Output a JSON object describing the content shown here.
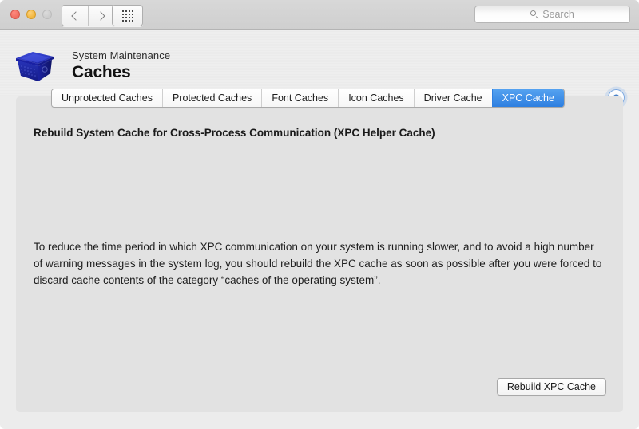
{
  "window": {
    "traffic_lights": [
      {
        "name": "close",
        "color": "#ef6c5f"
      },
      {
        "name": "minimize",
        "color": "#f0b43c"
      },
      {
        "name": "zoom",
        "color": "#cbcbcb"
      }
    ]
  },
  "toolbar": {
    "back_icon": "chevron-left-icon",
    "forward_icon": "chevron-right-icon",
    "grid_icon": "grid-view-icon",
    "search": {
      "icon": "search-icon",
      "placeholder": "Search",
      "value": ""
    }
  },
  "header": {
    "icon": "blue-crate-icon",
    "breadcrumb": "System Maintenance",
    "title": "Caches",
    "help_label": "?",
    "help_icon": "help-question-icon"
  },
  "tabs": [
    {
      "label": "Unprotected Caches",
      "selected": false
    },
    {
      "label": "Protected Caches",
      "selected": false
    },
    {
      "label": "Font Caches",
      "selected": false
    },
    {
      "label": "Icon Caches",
      "selected": false
    },
    {
      "label": "Driver Cache",
      "selected": false
    },
    {
      "label": "XPC Cache",
      "selected": true
    }
  ],
  "main": {
    "heading": "Rebuild System Cache for Cross-Process Communication (XPC Helper Cache)",
    "description": "To reduce the time period in which XPC communication on your system is running slower, and to avoid a high number of warning messages in the system log, you should rebuild the XPC cache as soon as possible after you were forced to discard cache contents of the category “caches of the operating system”.",
    "action_button": "Rebuild XPC Cache"
  },
  "colors": {
    "accent": "#2e7fe0",
    "tab_selected_top": "#55a2f0",
    "panel_bg": "#e2e2e2",
    "header_bg": "#eeeeee",
    "titlebar_bg": "#d2d2d2"
  }
}
